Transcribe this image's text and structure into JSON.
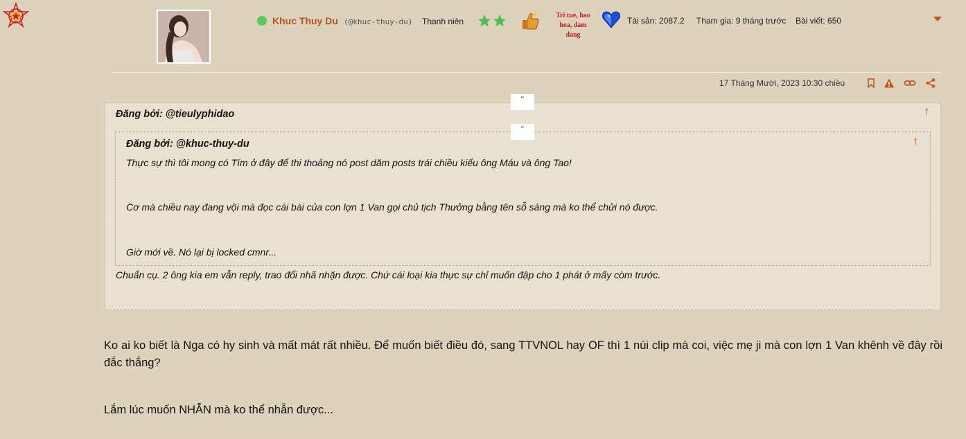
{
  "user": {
    "name": "Khuc Thuy Du",
    "handle": "(@khuc-thuy-du)",
    "rank": "Thanh niên",
    "trophy_text_line1": "Tri tue, hao",
    "trophy_text_line2": "hoa, dam dang",
    "assets": "Tài sản: 2087.2",
    "joined": "Tham gia: 9 tháng trước",
    "posts": "Bài viết: 650",
    "online_color": "#5cc85a",
    "star_count": 2
  },
  "post": {
    "date": "17 Tháng Mười, 2023 10:30 chiều",
    "actions": [
      "bookmark-icon",
      "report-icon",
      "link-icon",
      "share-icon"
    ]
  },
  "quote_outer": {
    "mark": "“",
    "author": "Đăng bởi: @tieulyphidao",
    "text": "Chuẩn cụ. 2 ông kia em vẫn reply, trao đổi nhã nhặn được. Chứ cái loại kia thực sự chỉ muốn đập cho 1 phát ở mấy còm trước."
  },
  "quote_inner": {
    "mark": "“",
    "author": "Đăng bởi: @khuc-thuy-du",
    "line1": "Thực sự thì tôi mong có Tím ở đây để thi thoảng nó post dăm posts trái chiều kiểu ông Máu và ông Tao!",
    "line2": "Cơ mà chiều nay đang vội mà đọc cái bài của con lợn 1 Van gọi chủ tịch Thưởng bằng tên sỗ sàng mà ko thể chửi nó được.",
    "line3": "Giờ mới về. Nó lại bị locked cmnr..."
  },
  "body": {
    "p1": "Ko ai ko biết là Nga có hy sinh và mất mát rất nhiều. Để muốn biết điều đó, sang TTVNOL hay OF thì 1 núi clip mà coi, việc mẹ ji mà con lợn 1 Van khênh về đây rồi đắc thắng?",
    "p2": "Lắm lúc muốn NHẪN mà ko thể nhẫn được..."
  },
  "colors": {
    "accent": "#b8531c",
    "background": "#ddd3bd",
    "quote_bg": "#e9e1d0"
  }
}
